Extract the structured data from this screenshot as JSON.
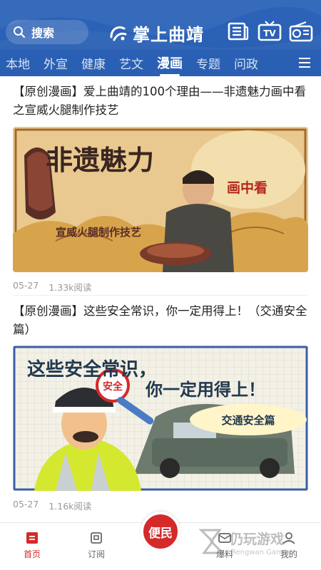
{
  "header": {
    "search_label": "搜索",
    "logo_text": "掌上曲靖",
    "icons": [
      "search-icon",
      "logo-mark-icon",
      "newspaper-icon",
      "tv-icon",
      "radio-icon",
      "menu-icon"
    ],
    "tv_label": "TV",
    "accent_color": "#2a5fb3"
  },
  "tabs": [
    "本地",
    "外宣",
    "健康",
    "艺文",
    "漫画",
    "专题",
    "问政"
  ],
  "active_tab": "漫画",
  "articles": [
    {
      "title": "【原创漫画】爱上曲靖的100个理由——非遗魅力画中看之宣威火腿制作技艺",
      "date": "05-27",
      "reads": "1.33k阅读",
      "image_headline": "非遗魅力",
      "image_sub": "画中看",
      "image_caption": "宣威火腿制作技艺"
    },
    {
      "title": "【原创漫画】这些安全常识，你一定用得上！（交通安全篇）",
      "date": "05-27",
      "reads": "1.16k阅读",
      "image_headline_1": "这些安全常识，",
      "image_headline_2": "你一定用得上！",
      "image_badge": "交通安全篇",
      "sign_text": "安全"
    }
  ],
  "bottom_nav": {
    "items": [
      "首页",
      "订阅",
      "爆料",
      "我的"
    ],
    "center": "便民",
    "active": "首页",
    "active_color": "#d42a2a"
  },
  "watermark": {
    "text": "仍玩游戏",
    "sub": "Rengwan Games"
  }
}
